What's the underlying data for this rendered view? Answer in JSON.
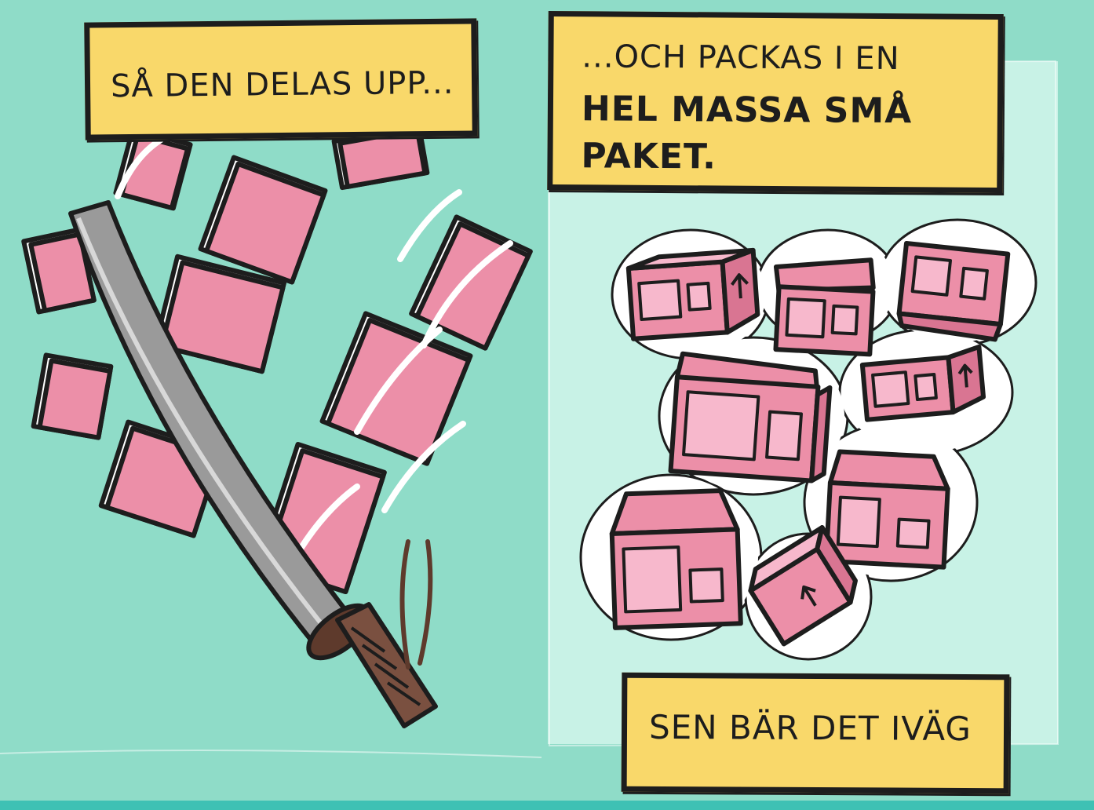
{
  "panel_left": {
    "caption": "SÅ DEN DELAS UPP..."
  },
  "panel_right": {
    "caption_line1": "...OCH PACKAS I EN",
    "caption_line2": "HEL MASSA SMÅ",
    "caption_line3": "PAKET.",
    "caption_bottom": "SEN BÄR DET IVÄG"
  },
  "colors": {
    "background": "#8fdcc8",
    "panel_light": "#c8f2e6",
    "caption_yellow": "#f9d86a",
    "package_pink": "#ec8fa8",
    "package_light": "#f7b8cc",
    "ink": "#1d1d1d",
    "blade": "#9a9a9a",
    "handle": "#7a5040"
  }
}
